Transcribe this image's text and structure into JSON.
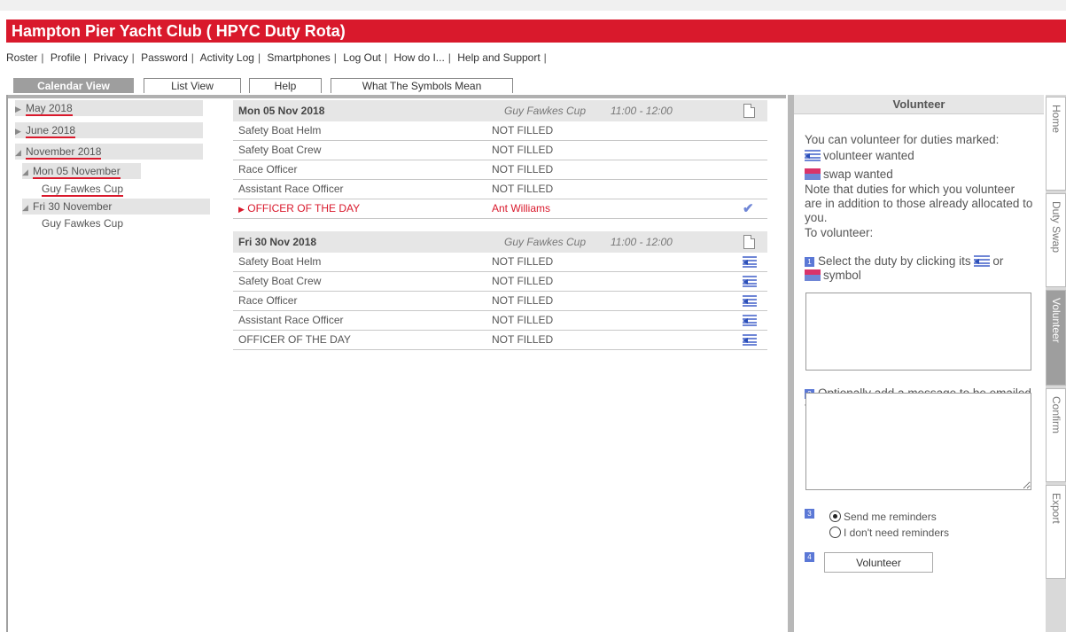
{
  "app": {
    "title": "Hampton Pier Yacht Club ( HPYC Duty Rota)"
  },
  "menu": [
    "Roster",
    "Profile",
    "Privacy",
    "Password",
    "Activity Log",
    "Smartphones",
    "Log Out",
    "How do I...",
    "Help and Support"
  ],
  "tabs": {
    "calendar": "Calendar View",
    "list": "List View",
    "help": "Help",
    "symbols": "What The Symbols Mean"
  },
  "tree": {
    "may": "May 2018",
    "june": "June 2018",
    "november": "November 2018",
    "mon05": "Mon 05 November",
    "mon05_event": "Guy Fawkes Cup",
    "fri30": "Fri 30 November",
    "fri30_event": "Guy Fawkes Cup"
  },
  "events": [
    {
      "date": "Mon 05 Nov 2018",
      "name": "Guy Fawkes Cup",
      "time": "11:00 - 12:00",
      "duties": [
        {
          "role": "Safety Boat Helm",
          "who": "NOT FILLED"
        },
        {
          "role": "Safety Boat Crew",
          "who": "NOT FILLED"
        },
        {
          "role": "Race Officer",
          "who": "NOT FILLED"
        },
        {
          "role": "Assistant Race Officer",
          "who": "NOT FILLED"
        },
        {
          "role": "OFFICER OF THE DAY",
          "who": "Ant Williams"
        }
      ]
    },
    {
      "date": "Fri 30 Nov 2018",
      "name": "Guy Fawkes Cup",
      "time": "11:00 - 12:00",
      "duties": [
        {
          "role": "Safety Boat Helm",
          "who": "NOT FILLED"
        },
        {
          "role": "Safety Boat Crew",
          "who": "NOT FILLED"
        },
        {
          "role": "Race Officer",
          "who": "NOT FILLED"
        },
        {
          "role": "Assistant Race Officer",
          "who": "NOT FILLED"
        },
        {
          "role": "OFFICER OF THE DAY",
          "who": "NOT FILLED"
        }
      ]
    }
  ],
  "checkmark": "✔",
  "volunteer": {
    "heading": "Volunteer",
    "intro": "You can volunteer for duties marked:",
    "volunteer_wanted": "volunteer wanted",
    "swap_wanted": "swap wanted",
    "note": "Note that duties for which you volunteer are in addition to those already allocated to you.",
    "to_volunteer": "To volunteer:",
    "step1_num": "1",
    "step1_a": "Select the duty by clicking its",
    "step1_b": "or",
    "step1_c": "symbol",
    "step2_num": "2",
    "step2": "Optionally add a message to be emailed to all concerned",
    "step3_num": "3",
    "reminder_on": "Send me reminders",
    "reminder_off": "I don't need reminders",
    "step4_num": "4",
    "button": "Volunteer"
  },
  "side_tabs": [
    "Home",
    "Duty Swap",
    "Volunteer",
    "Confirm",
    "Export"
  ],
  "colors": {
    "brand": "#d9192c",
    "accent": "#6f86d6",
    "swap": "#d9336a"
  }
}
